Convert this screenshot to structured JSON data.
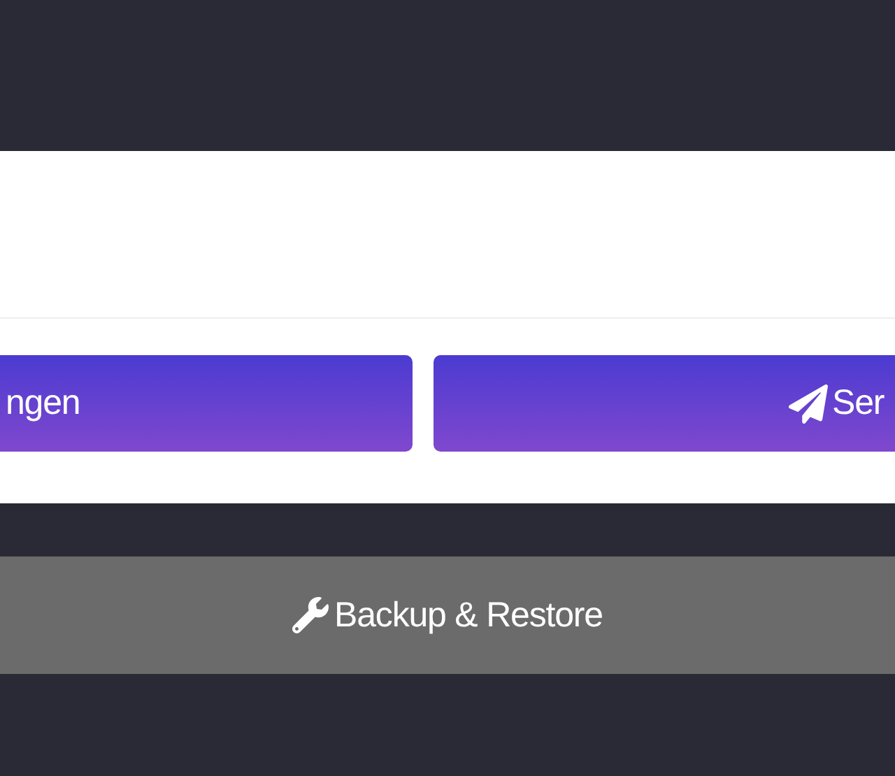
{
  "card": {
    "buttons": [
      {
        "label": "ngen",
        "kind": "plain"
      },
      {
        "label": "Ser",
        "kind": "send"
      }
    ]
  },
  "backup_button": {
    "label": "Backup & Restore",
    "kind": "wrench"
  }
}
